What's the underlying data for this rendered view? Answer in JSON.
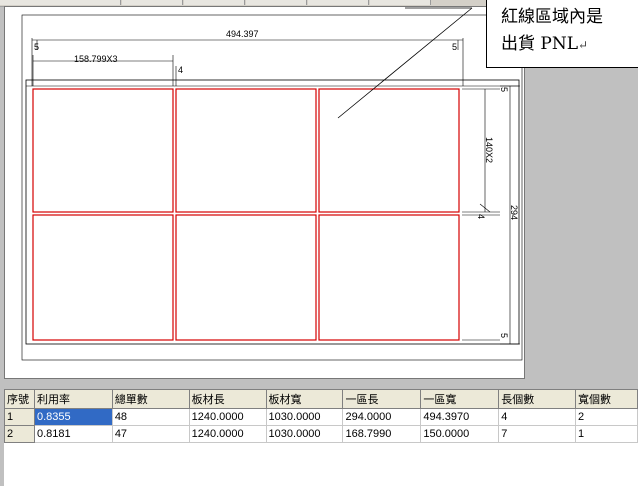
{
  "annotation": {
    "line1": "紅線區域內是",
    "line2": "出貨 PNL",
    "newline_mark": "↵"
  },
  "drawing": {
    "dimensions": {
      "panel_width": "494.397",
      "unit_width": "158.799X3",
      "unit_height": "140X2",
      "panel_height": "294",
      "gap": "4",
      "margin_left": "5",
      "margin_right": "5",
      "margin_top": "5",
      "margin_bottom": "5",
      "gap_vertical": "4"
    },
    "colors": {
      "unit_border": "#d40000",
      "outline": "#000000"
    }
  },
  "table": {
    "columns": [
      "序號",
      "利用率",
      "總單數",
      "板材長",
      "板材寬",
      "一區長",
      "一區寬",
      "長個數",
      "寬個數"
    ],
    "rows": [
      {
        "no": "1",
        "util": "0.8355",
        "orders": "48",
        "board_len": "1240.0000",
        "board_wid": "1030.0000",
        "zone_len": "294.0000",
        "zone_wid": "494.3970",
        "len_count": "4",
        "wid_count": "2"
      },
      {
        "no": "2",
        "util": "0.8181",
        "orders": "47",
        "board_len": "1240.0000",
        "board_wid": "1030.0000",
        "zone_len": "168.7990",
        "zone_wid": "150.0000",
        "len_count": "7",
        "wid_count": "1"
      }
    ]
  }
}
